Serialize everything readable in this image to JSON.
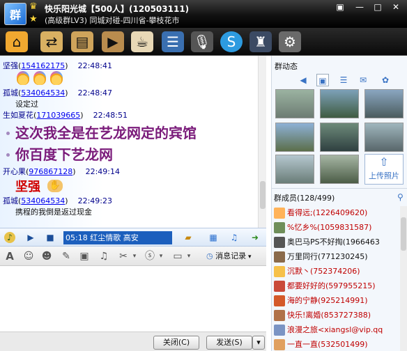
{
  "window": {
    "title": "快乐阳光城【500人】(120503111)",
    "subtitle": "(高级群LV3) 同城对碰-四川省-攀枝花市",
    "badge_text": "群"
  },
  "toolbar": {
    "icons": [
      "home-icon",
      "share-icon",
      "album-icon",
      "video-icon",
      "coffee-icon",
      "notice-icon",
      "microphone-icon",
      "soso-icon",
      "admin-icon",
      "settings-icon"
    ]
  },
  "chat": {
    "messages": [
      {
        "nick": "坚强",
        "qq": "154162175",
        "time": "22:48:41"
      },
      {
        "nick": "孤城",
        "qq": "534064534",
        "time": "22:48:47",
        "text": "设定过"
      },
      {
        "nick": "生如夏花",
        "qq": "171039665",
        "time": "22:48:51",
        "lines": [
          "这次我全是在艺龙网定的宾馆",
          "你百度下艺龙网"
        ]
      },
      {
        "nick": "开心果",
        "qq": "976867128",
        "time": "22:49:14",
        "text": "坚强"
      },
      {
        "nick": "孤城",
        "qq": "534064534",
        "time": "22:49:23",
        "text": "携程的我倒是返过现金"
      }
    ]
  },
  "music": {
    "song": "05:18 红尘情歌  高安"
  },
  "input_toolbar": {
    "history_label": "消息记录"
  },
  "buttons": {
    "close": "关闭(C)",
    "send": "发送(S)"
  },
  "right_panel": {
    "dynamics_title": "群动态",
    "upload_label": "上传照片",
    "members_title": "群成员(128/499)",
    "members": [
      {
        "name": "看得远;(1226409620)",
        "color": "#c00000"
      },
      {
        "name": "%忆乡%(1059831587)",
        "color": "#c00000"
      },
      {
        "name": "奥巴马PS不好掏(1966463",
        "color": "#111111"
      },
      {
        "name": "万里同行(771230245)",
        "color": "#111111"
      },
      {
        "name": "沉默丶(752374206)",
        "color": "#c00000"
      },
      {
        "name": "都要好好的(597955215)",
        "color": "#c00000"
      },
      {
        "name": "海的宁静(925214991)",
        "color": "#c00000"
      },
      {
        "name": "快乐!离婚(853727388)",
        "color": "#c00000"
      },
      {
        "name": "浪漫之旅<xiangsl@vip.qq",
        "color": "#c00000"
      },
      {
        "name": "一直一直(532501499)",
        "color": "#c00000"
      }
    ]
  },
  "colors": {
    "accent": "#1c5fbd",
    "member_red": "#c00000",
    "chat_purple": "#7a1b7a"
  }
}
